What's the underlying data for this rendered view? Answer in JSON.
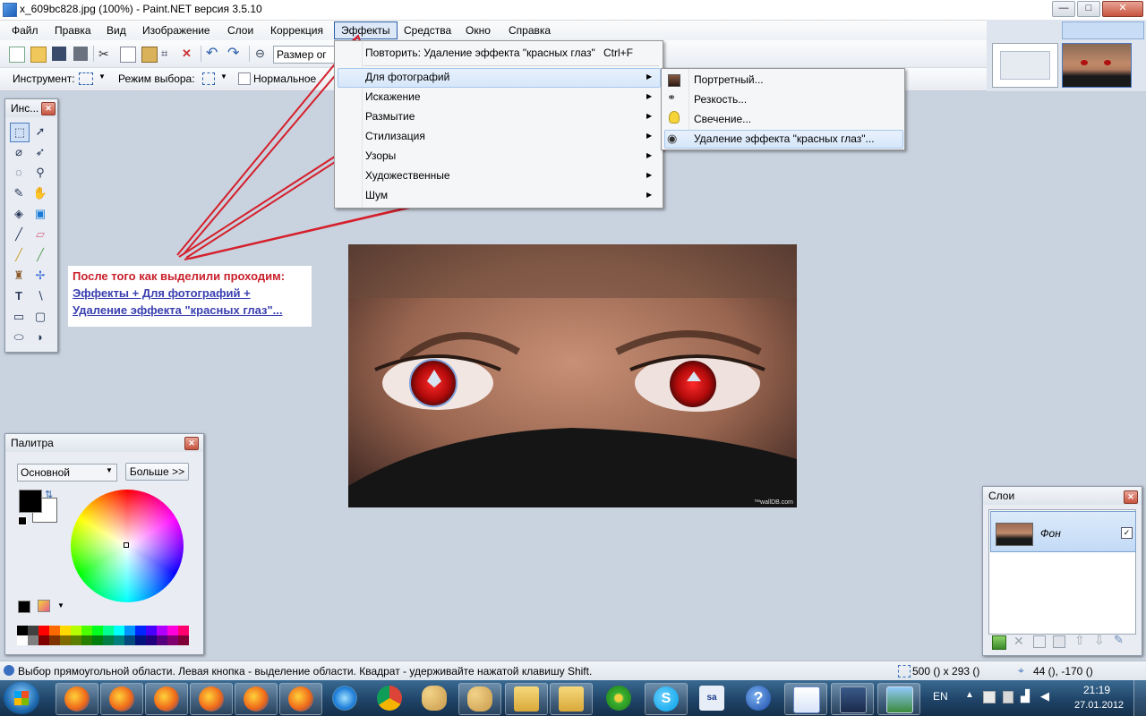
{
  "window": {
    "title": "x_609bc828.jpg (100%) - Paint.NET версия 3.5.10",
    "controls": {
      "minimize": "—",
      "maximize": "□",
      "close": "✕"
    }
  },
  "menubar": {
    "items": [
      "Файл",
      "Правка",
      "Вид",
      "Изображение",
      "Слои",
      "Коррекция",
      "Эффекты",
      "Средства",
      "Окно",
      "Справка"
    ],
    "active": "Эффекты"
  },
  "toolbar": {
    "zoom_combo": "Размер ог",
    "tool_label": "Инструмент:",
    "selection_mode_label": "Режим выбора:",
    "blend_mode": "Нормальное"
  },
  "effects_menu": {
    "repeat_label": "Повторить: Удаление эффекта \"красных глаз\"",
    "repeat_shortcut": "Ctrl+F",
    "items": [
      "Для фотографий",
      "Искажение",
      "Размытие",
      "Стилизация",
      "Узоры",
      "Художественные",
      "Шум"
    ],
    "highlighted": "Для фотографий"
  },
  "photo_submenu": {
    "items": [
      {
        "label": "Портретный...",
        "icon": "portrait-icon"
      },
      {
        "label": "Резкость...",
        "icon": "glasses-icon"
      },
      {
        "label": "Свечение...",
        "icon": "lightbulb-icon"
      },
      {
        "label": "Удаление эффекта \"красных глаз\"...",
        "icon": "eye-icon"
      }
    ],
    "highlighted": "Удаление эффекта \"красных глаз\"..."
  },
  "tools_panel": {
    "title": "Инс..."
  },
  "annotation": {
    "line1": "После того как выделили проходим:",
    "line2": "Эффекты + Для фотографий +",
    "line3": "Удаление эффекта \"красных глаз\"...",
    "color": "#c8202c"
  },
  "canvas": {
    "watermark": "™wallDB.com"
  },
  "palette": {
    "title": "Палитра",
    "mode": "Основной",
    "more_button": "Больше >>",
    "primary_color": "#000000",
    "secondary_color": "#ffffff"
  },
  "layers": {
    "title": "Слои",
    "items": [
      {
        "name": "Фон",
        "visible": true
      }
    ]
  },
  "statusbar": {
    "hint": "Выбор прямоугольной области. Левая кнопка - выделение области. Квадрат - удерживайте нажатой клавишу Shift.",
    "selection_size": "500 () x 293 ()",
    "cursor_pos": "44 (), -170 ()"
  },
  "taskbar": {
    "lang": "EN",
    "time": "21:19",
    "date": "27.01.2012"
  }
}
